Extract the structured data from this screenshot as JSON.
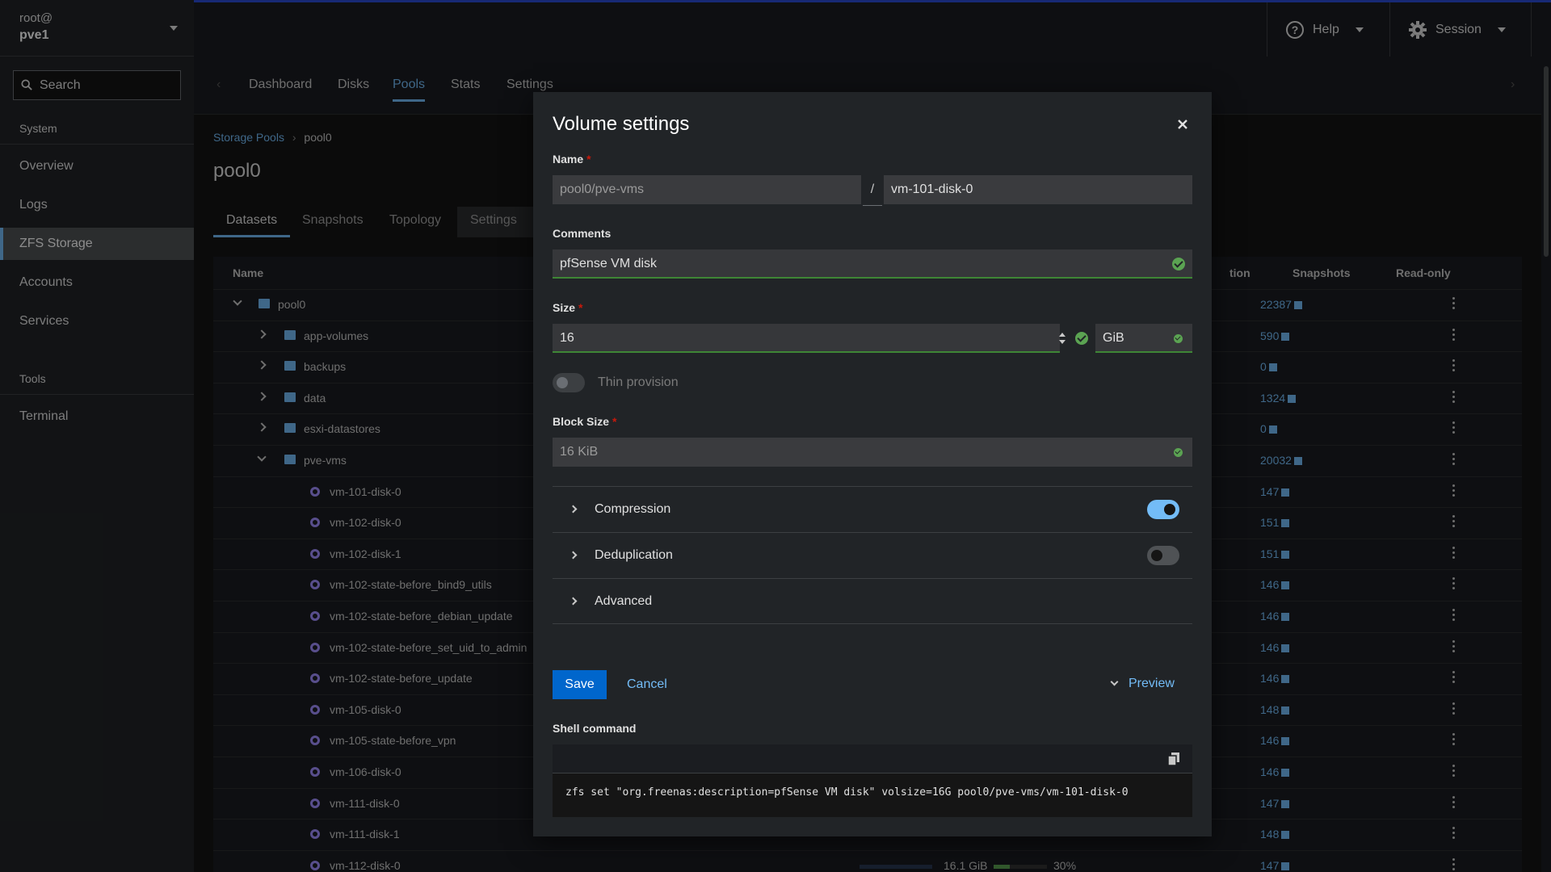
{
  "host": {
    "user": "root@",
    "name": "pve1"
  },
  "sidebar": {
    "search_label": "Search",
    "section_system": "System",
    "items": [
      {
        "label": "Overview"
      },
      {
        "label": "Logs"
      },
      {
        "label": "ZFS Storage",
        "active": true
      },
      {
        "label": "Accounts"
      },
      {
        "label": "Services"
      }
    ],
    "section_tools": "Tools",
    "tools_items": [
      {
        "label": "Terminal"
      }
    ]
  },
  "topbar": {
    "help": "Help",
    "session": "Session",
    "accent_color": "#2b4bd6"
  },
  "tabs": [
    "Dashboard",
    "Disks",
    "Pools",
    "Stats",
    "Settings"
  ],
  "active_tab": "Pools",
  "breadcrumb": {
    "parent": "Storage Pools",
    "current": "pool0"
  },
  "page_title": "pool0",
  "subtabs": [
    "Datasets",
    "Snapshots",
    "Topology",
    "Settings"
  ],
  "table": {
    "headers": {
      "name": "Name",
      "snapshots": "Snapshots",
      "readonly": "Read-only",
      "partial": "tion"
    },
    "rows": [
      {
        "name": "pool0",
        "snapshots": "22387",
        "kind": "root"
      },
      {
        "name": "app-volumes",
        "snapshots": "590",
        "kind": "folder"
      },
      {
        "name": "backups",
        "snapshots": "0",
        "kind": "folder"
      },
      {
        "name": "data",
        "snapshots": "1324",
        "kind": "folder"
      },
      {
        "name": "esxi-datastores",
        "snapshots": "0",
        "kind": "folder"
      },
      {
        "name": "pve-vms",
        "snapshots": "20032",
        "kind": "open"
      },
      {
        "name": "vm-101-disk-0",
        "snapshots": "147",
        "kind": "disk"
      },
      {
        "name": "vm-102-disk-0",
        "snapshots": "151",
        "kind": "disk"
      },
      {
        "name": "vm-102-disk-1",
        "snapshots": "151",
        "kind": "disk"
      },
      {
        "name": "vm-102-state-before_bind9_utils",
        "snapshots": "146",
        "kind": "disk"
      },
      {
        "name": "vm-102-state-before_debian_update",
        "snapshots": "146",
        "kind": "disk"
      },
      {
        "name": "vm-102-state-before_set_uid_to_admin",
        "snapshots": "146",
        "kind": "disk"
      },
      {
        "name": "vm-102-state-before_update",
        "snapshots": "146",
        "kind": "disk"
      },
      {
        "name": "vm-105-disk-0",
        "snapshots": "148",
        "kind": "disk"
      },
      {
        "name": "vm-105-state-before_vpn",
        "snapshots": "146",
        "kind": "disk"
      },
      {
        "name": "vm-106-disk-0",
        "snapshots": "146",
        "kind": "disk"
      },
      {
        "name": "vm-111-disk-0",
        "snapshots": "147",
        "kind": "disk"
      },
      {
        "name": "vm-111-disk-1",
        "snapshots": "148",
        "kind": "disk"
      },
      {
        "name": "vm-112-disk-0",
        "snapshots": "147",
        "kind": "disk",
        "used": "16.1 GiB",
        "percent": "30%"
      }
    ]
  },
  "modal": {
    "title": "Volume settings",
    "name_label": "Name",
    "name_parent": "pool0/pve-vms",
    "name_sep": "/",
    "name_value": "vm-101-disk-0",
    "comments_label": "Comments",
    "comments_value": "pfSense VM disk",
    "size_label": "Size",
    "size_value": "16",
    "size_unit": "GiB",
    "thin_label": "Thin provision",
    "block_label": "Block Size",
    "block_value": "16 KiB",
    "compression_label": "Compression",
    "compression_on": true,
    "dedup_label": "Deduplication",
    "dedup_on": false,
    "advanced_label": "Advanced",
    "save": "Save",
    "cancel": "Cancel",
    "preview": "Preview",
    "shell_label": "Shell command",
    "shell_command": "zfs set \"org.freenas:description=pfSense VM disk\" volsize=16G pool0/pve-vms/vm-101-disk-0"
  }
}
